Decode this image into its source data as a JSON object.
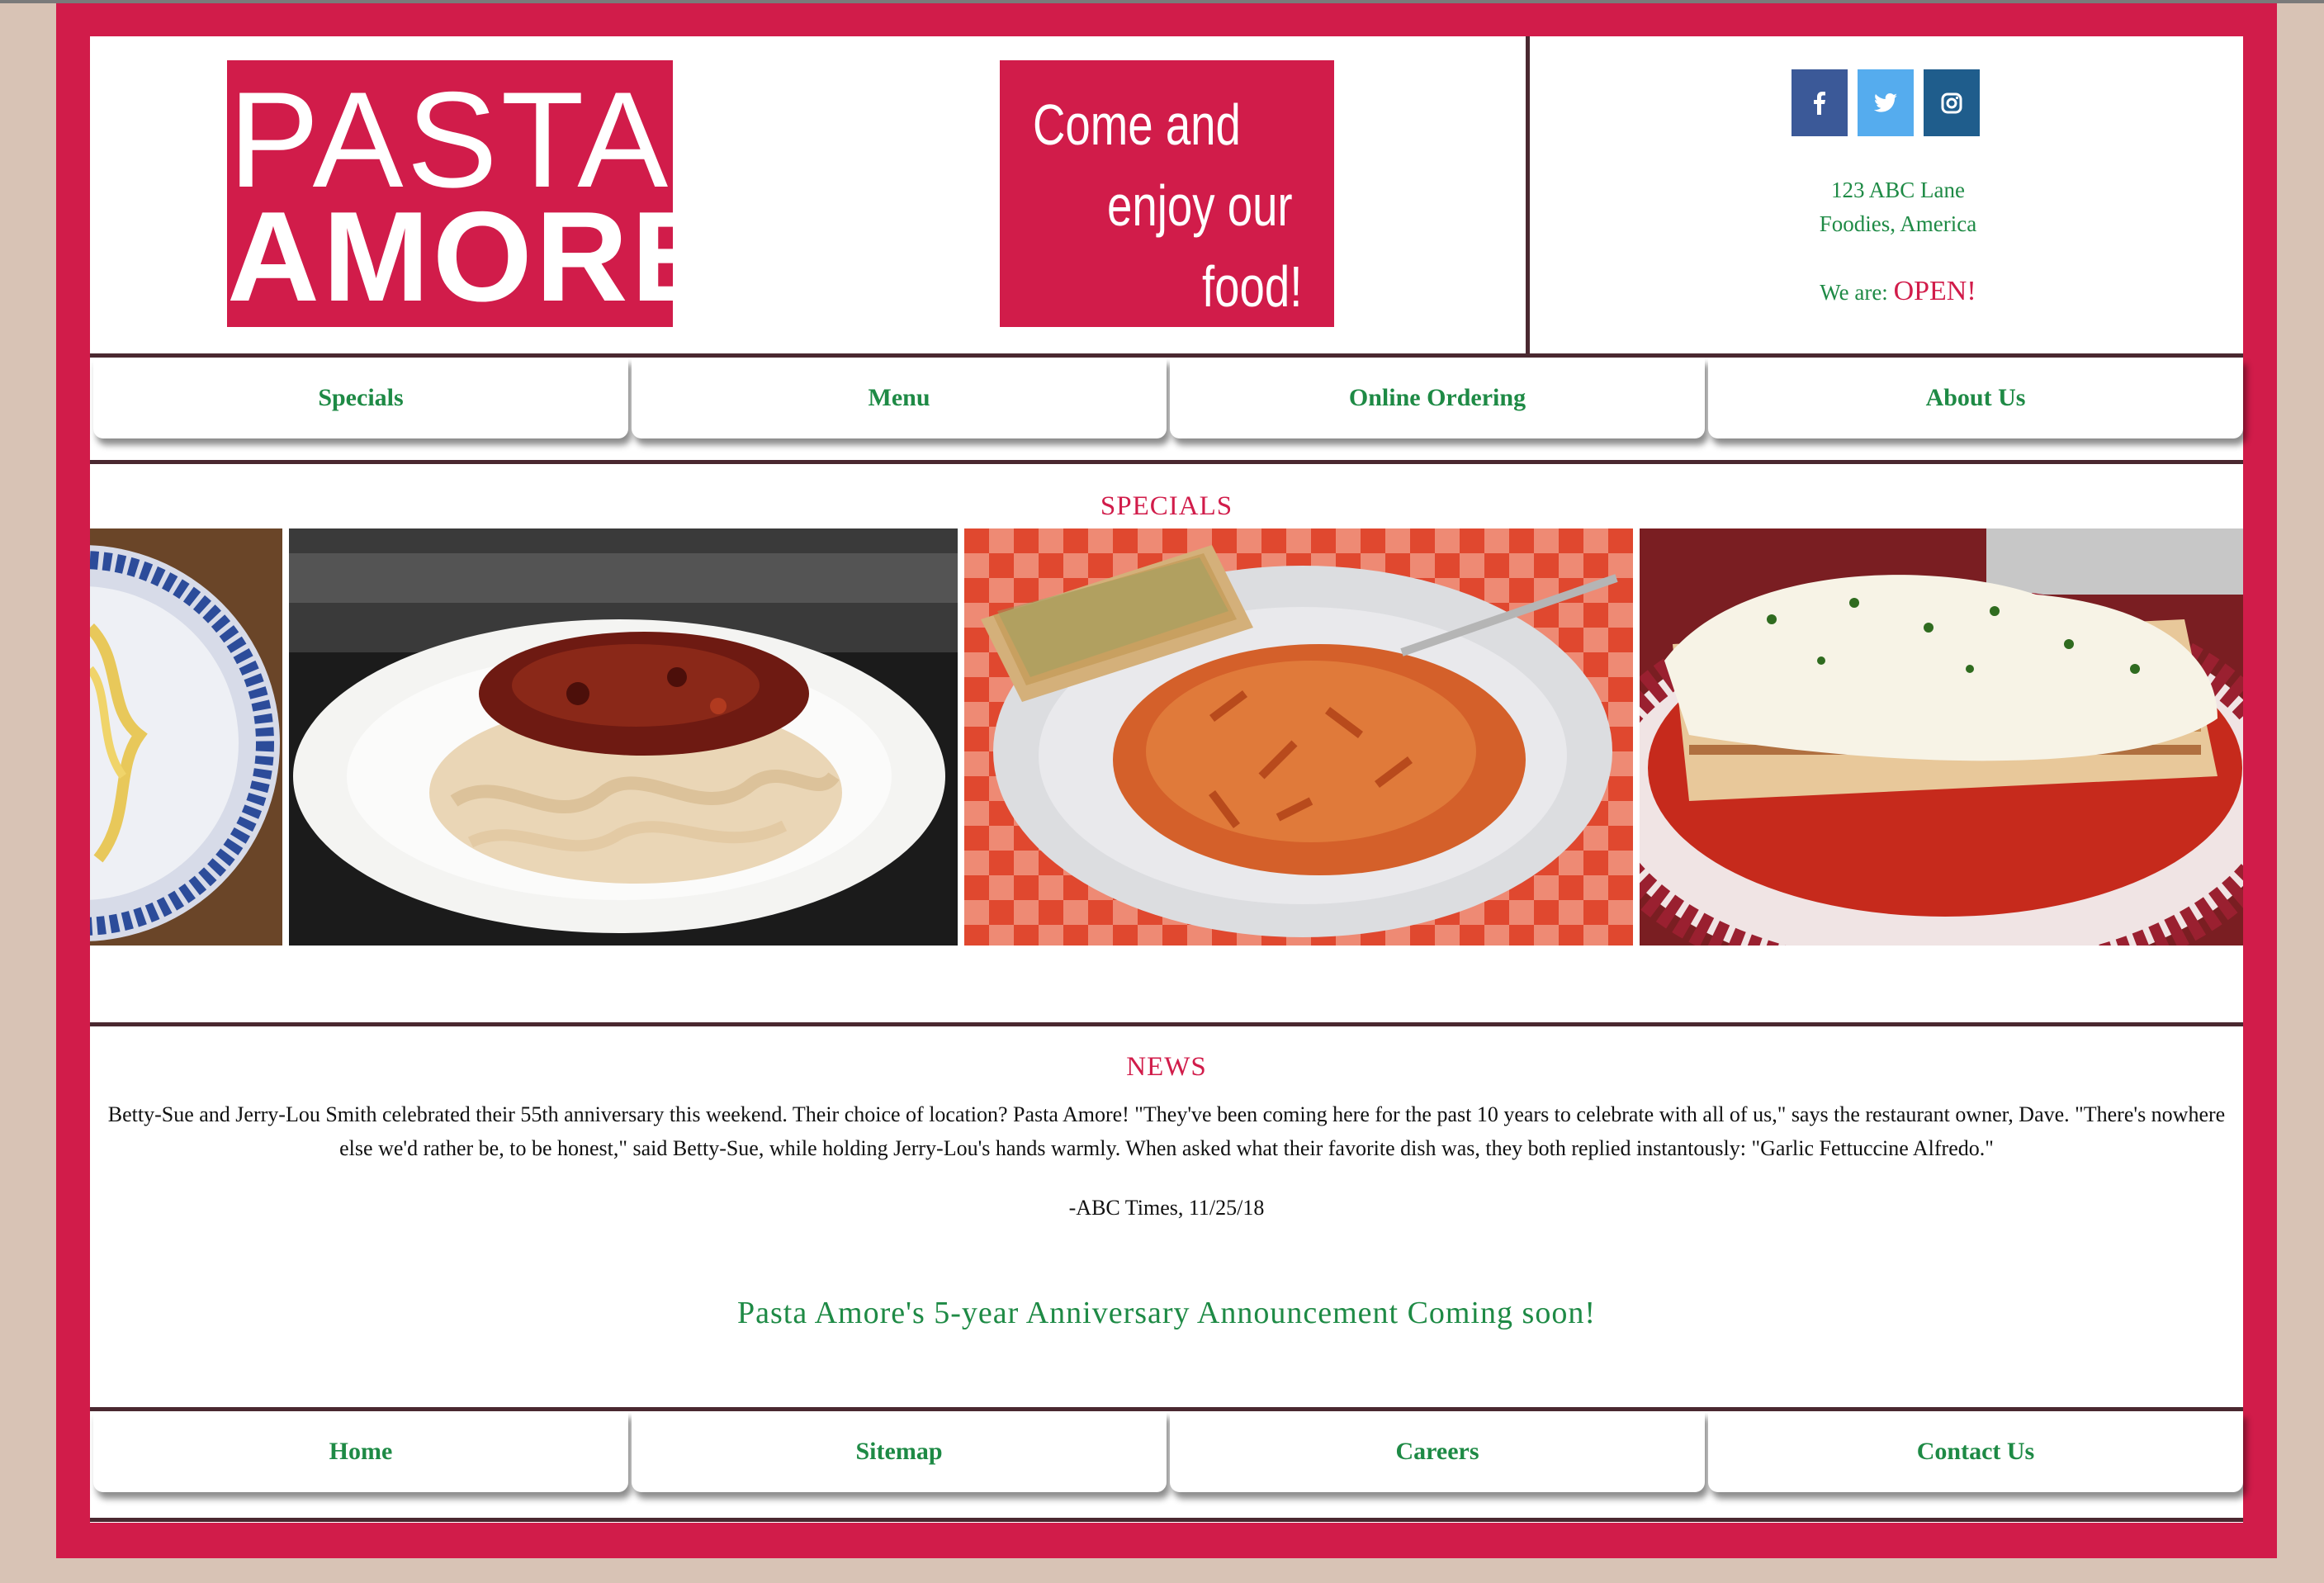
{
  "header": {
    "logo": {
      "line1": "PASTA",
      "line2": "AMORE"
    },
    "tagline": [
      "Come and",
      "enjoy our",
      "food!"
    ],
    "social": [
      {
        "name": "facebook",
        "glyph": "f",
        "color": "#3b5998"
      },
      {
        "name": "twitter",
        "glyph": "t",
        "color": "#55acee"
      },
      {
        "name": "instagram",
        "glyph": "◎",
        "color": "#1f5d8c"
      }
    ],
    "address": {
      "line1": "123 ABC Lane",
      "line2": "Foodies, America"
    },
    "status": {
      "label": "We are:",
      "value": "OPEN!"
    }
  },
  "nav": {
    "items": [
      "Specials",
      "Menu",
      "Online Ordering",
      "About Us"
    ]
  },
  "specials": {
    "title": "SPECIALS",
    "images": [
      "spaghetti-plate-partial",
      "fettuccine-bolognese",
      "penne-with-garlic-bread",
      "lasagna"
    ]
  },
  "news": {
    "title": "NEWS",
    "body": "Betty-Sue and Jerry-Lou Smith celebrated their 55th anniversary this weekend. Their choice of location? Pasta Amore! \"They've been coming here for the past 10 years to celebrate with all of us,\" says the restaurant owner, Dave. \"There's nowhere else we'd rather be, to be honest,\" said Betty-Sue, while holding Jerry-Lou's hands warmly. When asked what their favorite dish was, they both replied instantously: \"Garlic Fettuccine Alfredo.\"",
    "source": "-ABC Times, 11/25/18",
    "announcement": "Pasta Amore's 5-year Anniversary Announcement Coming soon!"
  },
  "footer": {
    "items": [
      "Home",
      "Sitemap",
      "Careers",
      "Contact Us"
    ]
  },
  "colors": {
    "brand": "#d11c4a",
    "accent_green": "#1e8a45",
    "divider": "#4a2830",
    "background": "#d8c3b5"
  }
}
